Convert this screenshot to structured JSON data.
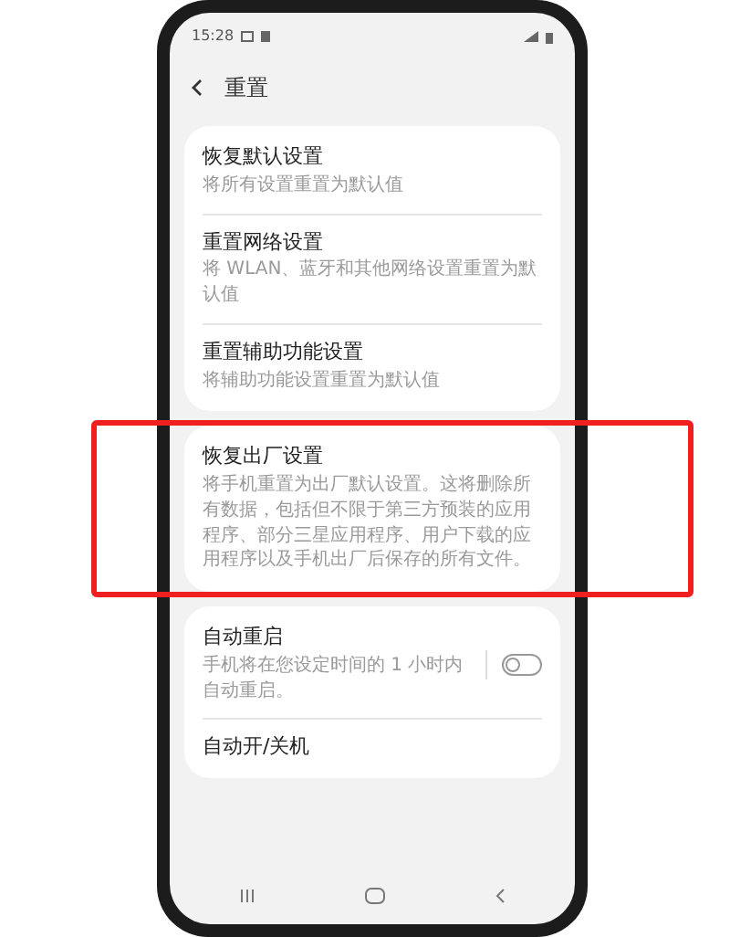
{
  "status_bar": {
    "time": "15:28"
  },
  "header": {
    "title": "重置"
  },
  "groups": [
    {
      "items": [
        {
          "kind": "plain",
          "title": "恢复默认设置",
          "subtitle": "将所有设置重置为默认值"
        },
        {
          "kind": "plain",
          "title": "重置网络设置",
          "subtitle": "将 WLAN、蓝牙和其他网络设置重置为默认值"
        },
        {
          "kind": "plain",
          "title": "重置辅助功能设置",
          "subtitle": "将辅助功能设置重置为默认值"
        }
      ]
    },
    {
      "highlighted": true,
      "items": [
        {
          "kind": "plain",
          "title": "恢复出厂设置",
          "subtitle": "将手机重置为出厂默认设置。这将删除所有数据，包括但不限于第三方预装的应用程序、部分三星应用程序、用户下载的应用程序以及手机出厂后保存的所有文件。"
        }
      ]
    },
    {
      "items": [
        {
          "kind": "toggle",
          "title": "自动重启",
          "subtitle": "手机将在您设定时间的 1 小时内自动重启。",
          "on": false
        },
        {
          "kind": "plain",
          "title": "自动开/关机"
        }
      ]
    }
  ]
}
